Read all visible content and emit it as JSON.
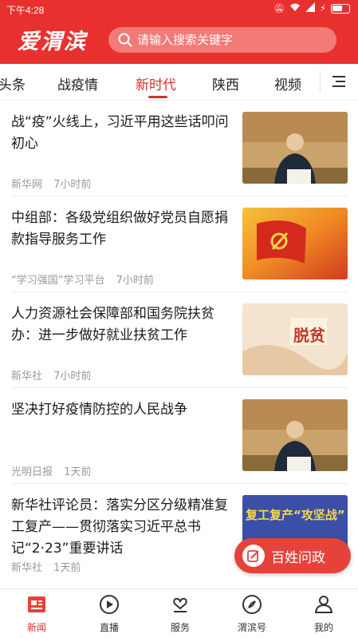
{
  "status_bar": {
    "time": "下午4:28",
    "icons": [
      "mute-icon",
      "wifi-icon",
      "signal-icon",
      "charging-icon",
      "battery-icon"
    ]
  },
  "header": {
    "logo_text": "爱渭滨",
    "search_placeholder": "请输入搜索关键字",
    "color": "#e8312f"
  },
  "tabs": [
    {
      "label": "头条"
    },
    {
      "label": "战疫情"
    },
    {
      "label": "新时代",
      "active": true
    },
    {
      "label": "陕西"
    },
    {
      "label": "视频"
    }
  ],
  "news": [
    {
      "title": "战“疫”火线上，习近平用这些话叩问初心",
      "source": "新华网",
      "time": "7小时前",
      "thumb": "meeting-photo"
    },
    {
      "title": "中组部：各级党组织做好党员自愿捐款指导服务工作",
      "source": "“学习强国”学习平台",
      "time": "7小时前",
      "thumb": "party-flag-image"
    },
    {
      "title": "人力资源社会保障部和国务院扶贫办：进一步做好就业扶贫工作",
      "source": "新华社",
      "time": "7小时前",
      "thumb": "poverty-alleviation-banner",
      "thumb_text": "脱贫"
    },
    {
      "title": "坚决打好疫情防控的人民战争",
      "source": "光明日报",
      "time": "1天前",
      "thumb": "meeting-photo"
    },
    {
      "title": "新华社评论员：落实分区分级精准复工复产——贯彻落实习近平总书记“2·23”重要讲话",
      "source": "新华社",
      "time": "1天前",
      "thumb": "resume-work-banner",
      "thumb_text": "复工复产“攻坚战”"
    }
  ],
  "floating_button": {
    "label": "百姓问政"
  },
  "bottom_nav": [
    {
      "label": "新闻",
      "icon": "news-icon",
      "active": true
    },
    {
      "label": "直播",
      "icon": "play-icon"
    },
    {
      "label": "服务",
      "icon": "service-icon"
    },
    {
      "label": "渭滨号",
      "icon": "compass-icon"
    },
    {
      "label": "我的",
      "icon": "user-icon"
    }
  ]
}
